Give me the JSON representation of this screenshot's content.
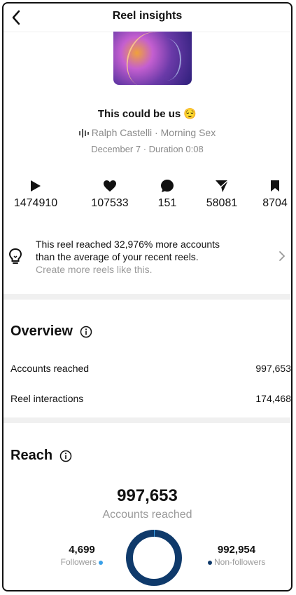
{
  "header": {
    "title": "Reel insights"
  },
  "reel": {
    "title": "This could be us 😌",
    "audio": "Ralph Castelli · Morning Sex",
    "meta": "December 7 · Duration 0:08"
  },
  "stats": [
    {
      "icon": "play-icon",
      "value": "1474910"
    },
    {
      "icon": "heart-icon",
      "value": "107533"
    },
    {
      "icon": "comment-icon",
      "value": "151"
    },
    {
      "icon": "share-icon",
      "value": "58081"
    },
    {
      "icon": "bookmark-icon",
      "value": "8704"
    }
  ],
  "banner": {
    "line1": "This reel reached 32,976% more accounts",
    "line2": "than the average of your recent reels.",
    "link": "Create more reels like this."
  },
  "overview": {
    "title": "Overview",
    "rows": [
      {
        "label": "Accounts reached",
        "value": "997,653"
      },
      {
        "label": "Reel interactions",
        "value": "174,468"
      }
    ]
  },
  "reach": {
    "title": "Reach",
    "total": "997,653",
    "total_label": "Accounts reached",
    "followers": "4,699",
    "followers_label": "Followers",
    "nonfollowers": "992,954",
    "nonfollowers_label": "Non-followers"
  },
  "colors": {
    "followers": "#3aa0e8",
    "nonfollowers": "#0f3a6b"
  }
}
